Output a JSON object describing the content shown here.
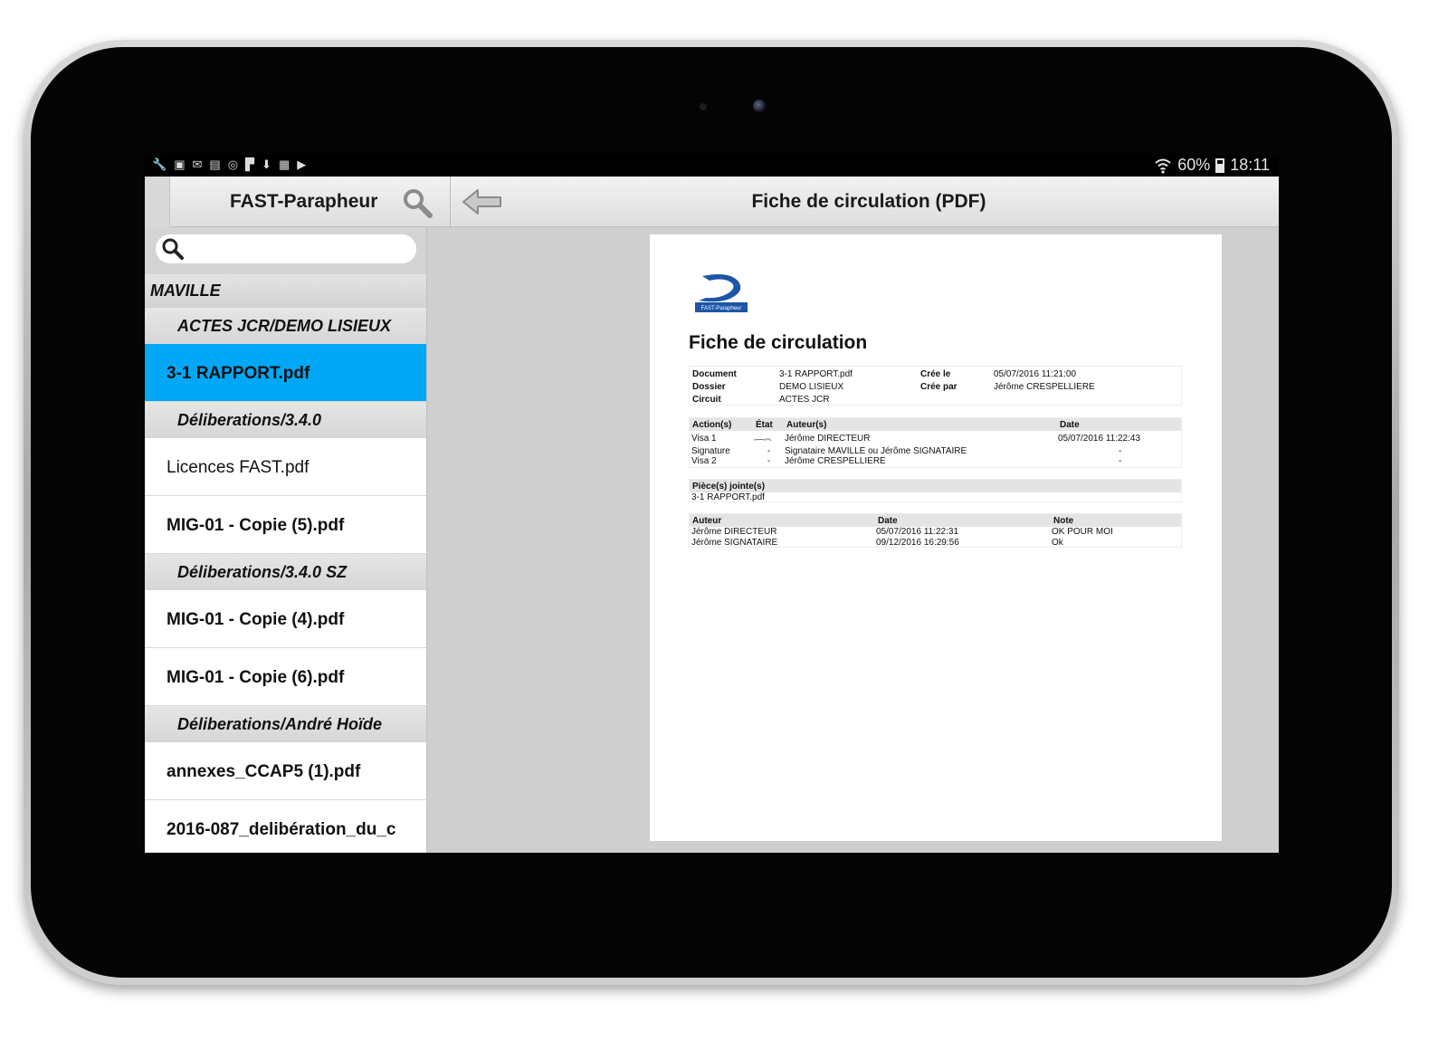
{
  "status_bar": {
    "icons": [
      "wrench-icon",
      "image-icon",
      "mail-icon",
      "screen-icon",
      "target-icon",
      "flag-icon",
      "download-icon",
      "bag-icon",
      "video-icon"
    ],
    "battery": "60%",
    "time": "18:11"
  },
  "app_bar": {
    "app_title": "FAST-Parapheur",
    "view_title": "Fiche de circulation (PDF)"
  },
  "sidebar": {
    "search_placeholder": "",
    "group": "MAVILLE",
    "folders": [
      {
        "name": "ACTES JCR/DEMO LISIEUX",
        "docs": [
          "3-1 RAPPORT.pdf"
        ]
      },
      {
        "name": "Déliberations/3.4.0",
        "docs": [
          "Licences FAST.pdf",
          "MIG-01 - Copie (5).pdf"
        ]
      },
      {
        "name": "Déliberations/3.4.0 SZ",
        "docs": [
          "MIG-01 - Copie (4).pdf",
          "MIG-01 - Copie (6).pdf"
        ]
      },
      {
        "name": "Déliberations/André Hoïde",
        "docs": [
          "annexes_CCAP5 (1).pdf",
          "2016-087_delibération_du_c"
        ]
      }
    ]
  },
  "pdf": {
    "logo_text": "FAST-Parapheur",
    "title": "Fiche de circulation",
    "info": {
      "document_label": "Document",
      "document_value": "3-1 RAPPORT.pdf",
      "dossier_label": "Dossier",
      "dossier_value": "DEMO LISIEUX",
      "circuit_label": "Circuit",
      "circuit_value": "ACTES JCR",
      "cree_le_label": "Crée le",
      "cree_le_value": "05/07/2016 11:21:00",
      "cree_par_label": "Crée par",
      "cree_par_value": "Jérôme CRESPELLIERE"
    },
    "actions": {
      "headers": [
        "Action(s)",
        "État",
        "Auteur(s)",
        "Date"
      ],
      "rows": [
        [
          "Visa 1",
          "",
          "Jérôme DIRECTEUR",
          "05/07/2016 11:22:43"
        ],
        [
          "Signature",
          "-",
          "Signataire MAVILLE ou Jérôme SIGNATAIRE",
          "-"
        ],
        [
          "Visa 2",
          "-",
          "Jérôme CRESPELLIERE",
          "-"
        ]
      ]
    },
    "pieces": {
      "header": "Pièce(s) jointe(s)",
      "rows": [
        "3-1 RAPPORT.pdf"
      ]
    },
    "notes": {
      "headers": [
        "Auteur",
        "Date",
        "Note"
      ],
      "rows": [
        [
          "Jérôme DIRECTEUR",
          "05/07/2016 11:22:31",
          "OK POUR MOI"
        ],
        [
          "Jérôme SIGNATAIRE",
          "09/12/2016 16:29:56",
          "Ok"
        ]
      ]
    }
  }
}
